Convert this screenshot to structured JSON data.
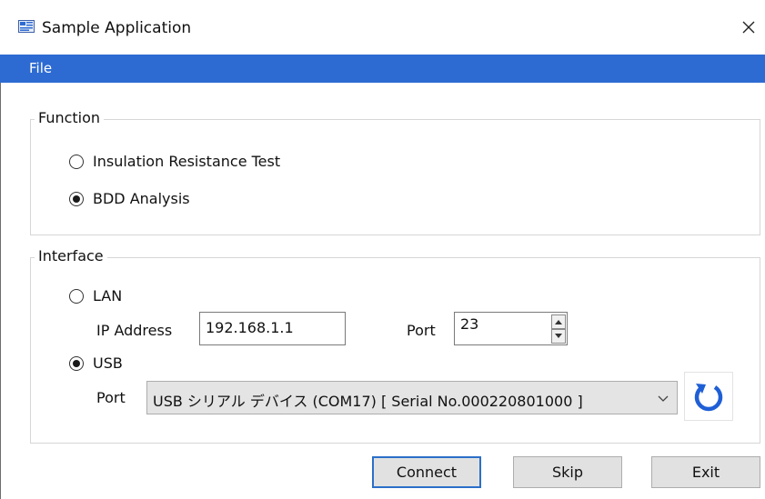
{
  "window": {
    "title": "Sample Application",
    "icon": "app-icon",
    "close_icon": "close-icon"
  },
  "menu": {
    "items": [
      {
        "label": "File"
      }
    ],
    "background_color": "#2d6bd2"
  },
  "function_group": {
    "label": "Function",
    "options": [
      {
        "label": "Insulation Resistance Test",
        "selected": false
      },
      {
        "label": "BDD Analysis",
        "selected": true
      }
    ]
  },
  "interface_group": {
    "label": "Interface",
    "lan": {
      "label": "LAN",
      "selected": false,
      "ip_label": "IP Address",
      "ip_value": "192.168.1.1",
      "port_label": "Port",
      "port_value": "23"
    },
    "usb": {
      "label": "USB",
      "selected": true,
      "port_label": "Port",
      "port_value": "USB シリアル デバイス (COM17)  [ Serial No.000220801000 ]"
    },
    "refresh_icon": "refresh-icon",
    "accent_color": "#1f5fd6"
  },
  "buttons": {
    "connect": "Connect",
    "skip": "Skip",
    "exit": "Exit"
  }
}
